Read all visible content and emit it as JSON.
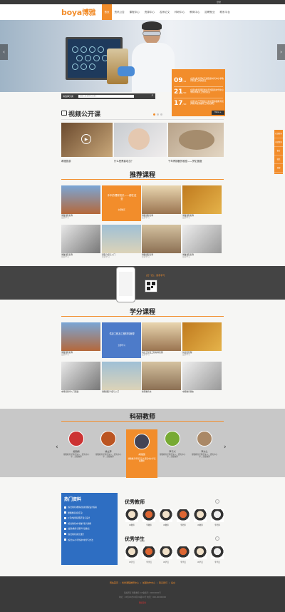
{
  "topbar": {
    "login": "登录"
  },
  "header": {
    "logo_en": "boya",
    "logo_cn": "博雅"
  },
  "nav": [
    "首页",
    "资讯公告",
    "课程中心",
    "资源中心",
    "名师论文",
    "科研中心",
    "教育中心",
    "招聘就业",
    "联系平台"
  ],
  "hero": {
    "news": [
      {
        "day": "09",
        "month": "/11",
        "title": "[最新]教育部关于加强新时代中小学教育科研工作的意见"
      },
      {
        "day": "21",
        "month": "/10",
        "title": "[最新]教育部印发关于加强新时代中小学科学教育工作的意见"
      },
      {
        "day": "17",
        "month": "/10",
        "title": "[最新]关于开展第三届全国基础教育优秀教学成果推荐工作的通知"
      }
    ],
    "more": "More +",
    "search_select": "请选择分类",
    "search_placeholder": "请输入要搜索的关键字",
    "search_icon": "search-icon"
  },
  "video": {
    "title": "视频公开课",
    "items": [
      "希腊旅游",
      "什么是黑客攻击？",
      "千年青铜器的秘密——梦幻国度"
    ]
  },
  "recommend": {
    "title": "推荐课程",
    "subtitle": "RECOMMENDED COURSE",
    "promo": "手中的理财知识——都在这里",
    "promo_sub": "立即购买",
    "cards": [
      {
        "name": "博雅课程名称",
        "sub": "立即学习"
      },
      {
        "name": "",
        "sub": ""
      },
      {
        "name": "博雅课程名称",
        "sub": "立即学习"
      },
      {
        "name": "博雅课程名称",
        "sub": "立即学习"
      },
      {
        "name": "博雅课程名称",
        "sub": "立即学习"
      },
      {
        "name": "课程介绍与入门",
        "sub": "立即学习"
      },
      {
        "name": "博雅课程名称",
        "sub": "立即学习"
      },
      {
        "name": "博雅课程名称",
        "sub": "立即学习"
      }
    ]
  },
  "app": {
    "title": "[扫一扫]，随手学习",
    "sub": "博雅APP"
  },
  "credit": {
    "title": "学分课程",
    "subtitle": "CREDIT COURSES",
    "promo": "供应工程及工程材料管理",
    "promo_sub": "立即学习",
    "cards": [
      {
        "name": "博雅课程名称",
        "sub": "立即学习"
      },
      {
        "name": "",
        "sub": ""
      },
      {
        "name": "供应工程及工程材料管理",
        "sub": "立即学习"
      },
      {
        "name": "供应链管理",
        "sub": "立即学习"
      },
      {
        "name": "市场营销学入门基础",
        "sub": ""
      },
      {
        "name": "博雅课程介绍与入门",
        "sub": ""
      },
      {
        "name": "外国教育史",
        "sub": ""
      },
      {
        "name": "中国教育简史",
        "sub": ""
      }
    ]
  },
  "teachers": {
    "title": "科研教师",
    "subtitle": "RESEARCH TEACHERS",
    "list": [
      {
        "name": "郑丽娟",
        "desc": "博雅教育学科带头人，研究中小学，高级教师"
      },
      {
        "name": "徐立萍",
        "desc": "博雅教育学科带头人，研究中小学，高级教师"
      },
      {
        "name": "胡建国",
        "desc": "博雅教育学科带头人研究中小学高级教师"
      },
      {
        "name": "李子兴",
        "desc": "博雅教育学科带头人，研究中小学，高级教师"
      },
      {
        "name": "李大仁",
        "desc": "博雅教育学科带头人，研究中小学，高级教师"
      }
    ]
  },
  "hot": {
    "title": "热门资料",
    "items": [
      "[综合教育]教师必备的课程设计指南",
      "博雅教育资源汇总",
      "公司内训师课程开发与设计",
      "[综合教育]中考数学复习资料",
      "[最新]教育心理学考试重点",
      "[综合教育]家长课堂",
      "[综合]从小学到初中的学习方法"
    ]
  },
  "excellent_teachers": {
    "title": "优秀教师",
    "names": [
      "W教师",
      "李教师",
      "W教师",
      "李老师",
      "W教师",
      "李老师"
    ]
  },
  "excellent_students": {
    "title": "优秀学生",
    "names": [
      "W学员",
      "李学员",
      "W学员",
      "李学员",
      "W学员",
      "李学员"
    ]
  },
  "footer": {
    "links": [
      "网站首页",
      "优秀课程推荐中心",
      "加盟合作中心",
      "联系我们",
      "后台"
    ],
    "copy1": "版权所有 博雅教育 ICP备案号: 00000000号",
    "copy2": "地址：XX省XX市XX区XX路XX号 电话：000-00000000",
    "badge": "网络警察"
  },
  "side": [
    "在线咨询",
    "电话咨询",
    "留言",
    "微信",
    "顶部"
  ],
  "colors": {
    "accent": "#f28d2b",
    "blue": "#2e6ec2"
  }
}
